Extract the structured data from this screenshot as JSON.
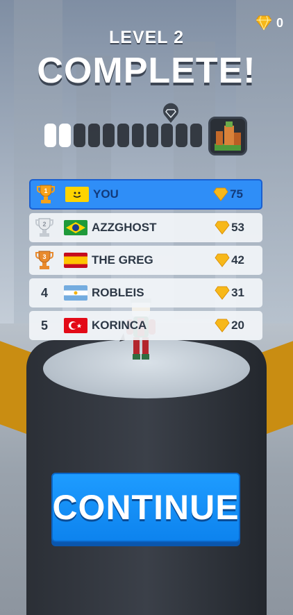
{
  "header": {
    "level_label": "LEVEL 2",
    "status_label": "COMPLETE!"
  },
  "gems": {
    "count": "0",
    "icon": "diamond-icon",
    "color": "#f7b81a"
  },
  "progress": {
    "segments_total": 11,
    "segments_done": 2,
    "marker_icon": "map-pin-diamond-icon",
    "goal_icon": "castle-level-icon"
  },
  "leaderboard": [
    {
      "rank": "1",
      "rank_icon": "gold-trophy-icon",
      "flag": "smiley-flag",
      "name": "YOU",
      "score": "75",
      "is_player": true
    },
    {
      "rank": "2",
      "rank_icon": "silver-trophy-icon",
      "flag": "brazil-flag",
      "name": "AZZGHOST",
      "score": "53",
      "is_player": false
    },
    {
      "rank": "3",
      "rank_icon": "bronze-trophy-icon",
      "flag": "spain-flag",
      "name": "THE GREG",
      "score": "42",
      "is_player": false
    },
    {
      "rank": "4",
      "rank_icon": "",
      "flag": "argentina-flag",
      "name": "ROBLEIS",
      "score": "31",
      "is_player": false
    },
    {
      "rank": "5",
      "rank_icon": "",
      "flag": "turkey-flag",
      "name": "KORINCA",
      "score": "20",
      "is_player": false
    }
  ],
  "continue_button": {
    "label": "CONTINUE",
    "color": "#1e9cff"
  }
}
